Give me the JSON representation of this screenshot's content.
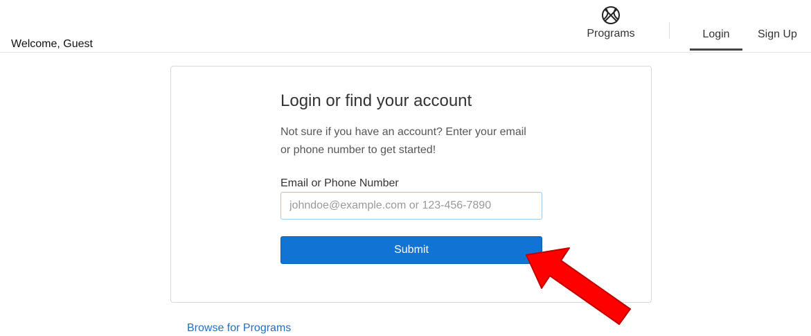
{
  "header": {
    "welcome_text": "Welcome, Guest",
    "nav": {
      "programs_label": "Programs",
      "programs_icon": "basketball-icon",
      "login_label": "Login",
      "signup_label": "Sign Up",
      "active_tab": "Login"
    }
  },
  "login_card": {
    "title": "Login or find your account",
    "subtitle": "Not sure if you have an account? Enter your email or phone number to get started!",
    "field_label": "Email or Phone Number",
    "input_placeholder": "johndoe@example.com or 123-456-7890",
    "input_value": "",
    "submit_label": "Submit"
  },
  "footer": {
    "browse_link": "Browse for Programs"
  },
  "colors": {
    "primary_button": "#1173d4",
    "link": "#1f6fc5",
    "annotation_arrow": "#ff0000"
  }
}
